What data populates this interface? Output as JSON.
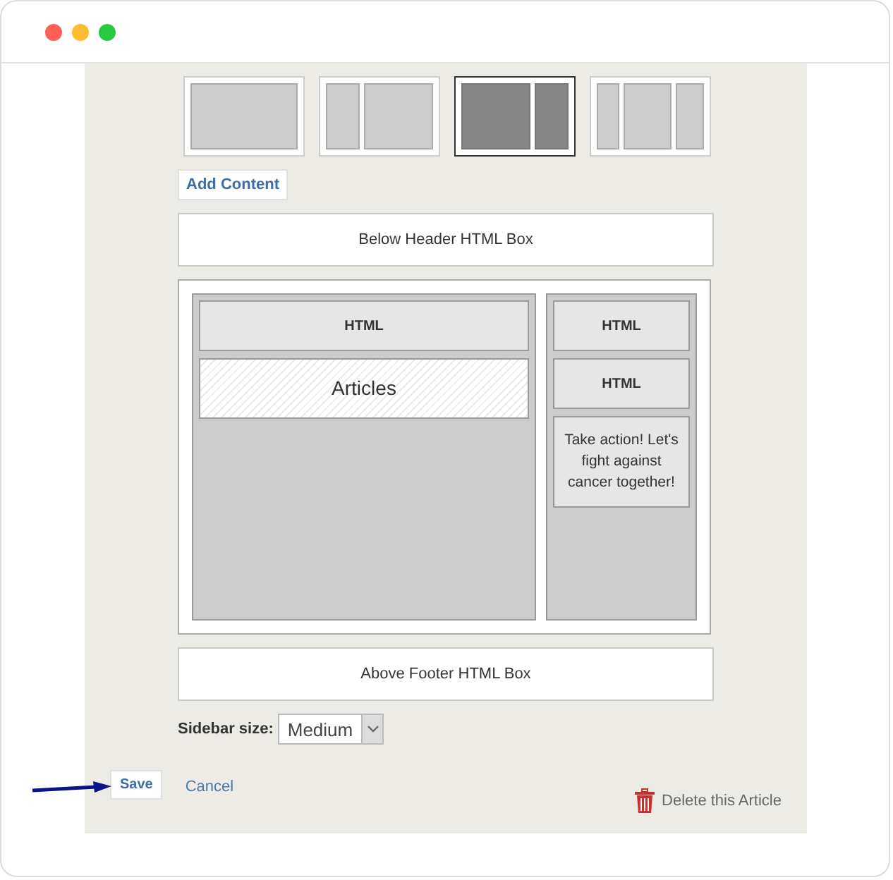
{
  "window": {
    "controls": [
      {
        "color": "#fe5f57"
      },
      {
        "color": "#febc2e"
      },
      {
        "color": "#28c840"
      }
    ]
  },
  "layouts": [
    {
      "kind": "full",
      "selected": false
    },
    {
      "kind": "left",
      "selected": false
    },
    {
      "kind": "right",
      "selected": true
    },
    {
      "kind": "three",
      "selected": false
    }
  ],
  "add_content": "Add Content",
  "below_header": "Below Header HTML Box",
  "main_column": [
    {
      "kind": "html",
      "label": "HTML"
    },
    {
      "kind": "articles",
      "label": "Articles"
    }
  ],
  "sidebar_column": [
    {
      "kind": "html",
      "label": "HTML"
    },
    {
      "kind": "html",
      "label": "HTML"
    },
    {
      "kind": "text",
      "label": "Take action! Let's fight against cancer together!"
    }
  ],
  "above_footer": "Above Footer HTML Box",
  "sidebar_size": {
    "label": "Sidebar size:",
    "value": "Medium"
  },
  "actions": {
    "save": "Save",
    "cancel": "Cancel",
    "delete": "Delete this Article"
  }
}
